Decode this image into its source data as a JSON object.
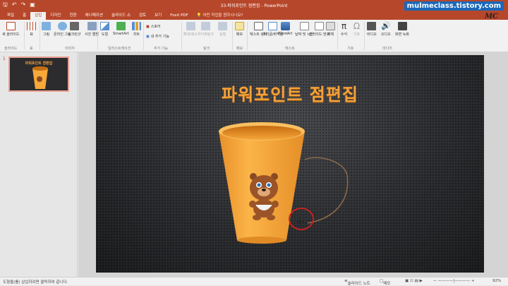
{
  "titlebar": {
    "title": "33-파워포인트 점편집 - PowerPoint",
    "watermark": "mulmeclass.tistory.com",
    "mascot_text": "MC"
  },
  "tabs": [
    {
      "label": "파일",
      "active": false
    },
    {
      "label": "홈",
      "active": false
    },
    {
      "label": "삽입",
      "active": true
    },
    {
      "label": "디자인",
      "active": false
    },
    {
      "label": "전환",
      "active": false
    },
    {
      "label": "애니메이션",
      "active": false
    },
    {
      "label": "슬라이드 쇼",
      "active": false
    },
    {
      "label": "검토",
      "active": false
    },
    {
      "label": "보기",
      "active": false
    },
    {
      "label": "Foxit PDF",
      "active": false
    }
  ],
  "tell_me": "어떤 작업을 원하시나요?",
  "ribbon": {
    "new_slide": "새 슬라이드",
    "table": "표",
    "picture": "그림",
    "online_picture": "온라인 그림",
    "screenshot": "스크린샷",
    "photo_album": "사진 앨범",
    "shapes": "도형",
    "smartart": "SmartArt",
    "chart": "차트",
    "store": "스토어",
    "my_addins": "내 추가 기능",
    "zoom": "확대/축소",
    "hyperlink": "하이퍼링크",
    "action": "실행",
    "comment": "메모",
    "textbox": "텍스트 상자",
    "header_footer": "머리글/바닥글",
    "wordart": "WordArt",
    "date_time": "날짜 및 시간",
    "slide_number": "슬라이드 번호",
    "object": "개체",
    "equation": "수식",
    "symbol": "기호",
    "video": "비디오",
    "audio": "오디오",
    "screen_recording": "화면 녹화",
    "groups": {
      "slides": "슬라이드",
      "tables": "표",
      "images": "이미지",
      "illustrations": "일러스트레이션",
      "addins": "추가 기능",
      "links": "링크",
      "comments": "메모",
      "text": "텍스트",
      "symbols": "기호",
      "media": "미디어"
    }
  },
  "thumbnail": {
    "number": "1",
    "title": "파워포인트 점편집"
  },
  "slide": {
    "title": "파워포인트 점편집"
  },
  "status": {
    "message": "도형을(를) 삽입하려면 클릭하여 끕니다.",
    "notes": "슬라이드 노트",
    "comments": "메모",
    "zoom": "92%"
  },
  "colors": {
    "accent": "#b7472a",
    "title_orange": "#f4a13a",
    "cup": "#f7a93a"
  }
}
